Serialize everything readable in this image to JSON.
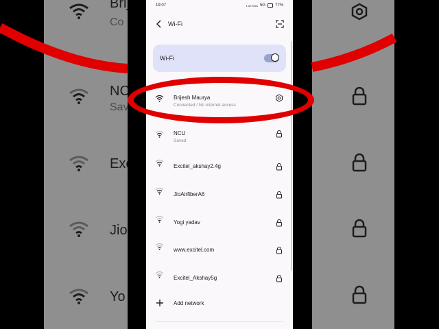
{
  "status_bar": {
    "time": "19:07",
    "network_speed": "1.00 KB/s",
    "signal": "5G",
    "battery": "77%"
  },
  "header": {
    "title": "Wi-Fi"
  },
  "wifi_toggle": {
    "label": "Wi-Fi",
    "state": "on"
  },
  "networks": [
    {
      "name": "Brijesh Maurya",
      "status": "Connected / No internet access",
      "trailing_icon": "settings-icon"
    },
    {
      "name": "NCU",
      "status": "Saved",
      "trailing_icon": "lock-icon"
    },
    {
      "name": "Excitel_akshay2.4g",
      "status": "",
      "trailing_icon": "lock-icon"
    },
    {
      "name": "JioAirfiberA6",
      "status": "",
      "trailing_icon": "lock-icon"
    },
    {
      "name": "Yogi yadav",
      "status": "",
      "trailing_icon": "lock-icon"
    },
    {
      "name": "www.excitel.com",
      "status": "",
      "trailing_icon": "lock-icon"
    },
    {
      "name": "Excitel_Akshay5g",
      "status": "",
      "trailing_icon": "lock-icon"
    }
  ],
  "add_network": {
    "label": "Add network"
  },
  "background_copy": {
    "left_items": [
      "Brij",
      "Co",
      "NC",
      "Sav",
      "Exci",
      "Jio",
      "Yo"
    ],
    "annotation_color": "#e00000"
  },
  "colors": {
    "accent_card": "#dfe2f8",
    "annotation": "#e00000",
    "background": "#fbf8fb"
  }
}
